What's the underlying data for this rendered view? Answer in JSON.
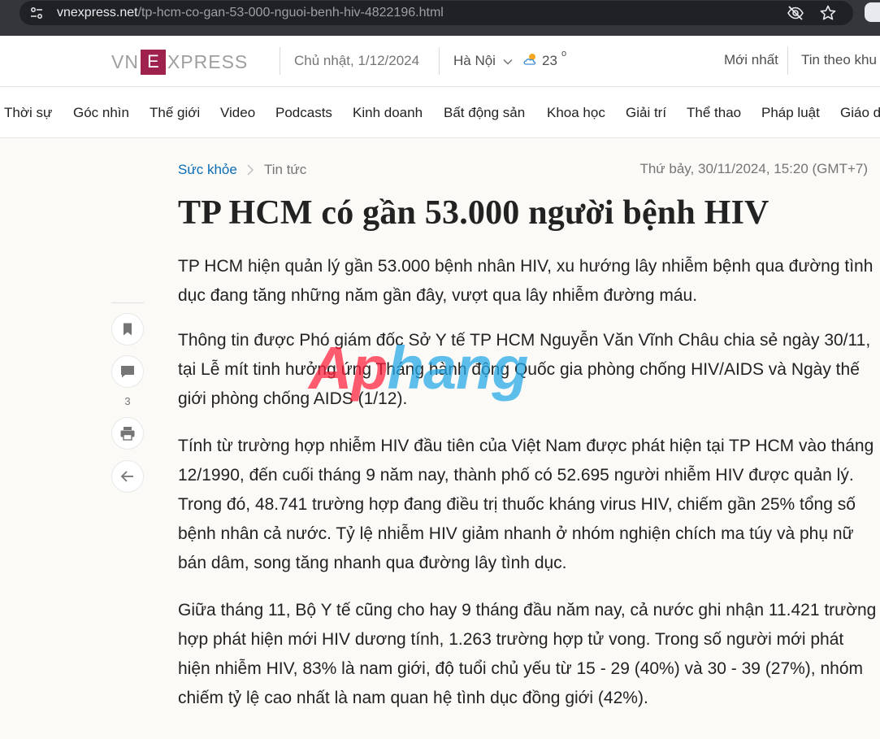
{
  "browser": {
    "url_domain": "vnexpress.net",
    "url_path": "/tp-hcm-co-gan-53-000-nguoi-benh-hiv-4822196.html"
  },
  "header": {
    "logo_left": "VN",
    "logo_e": "E",
    "logo_right": "XPRESS",
    "date": "Chủ nhật, 1/12/2024",
    "city": "Hà Nội",
    "temperature": "23",
    "degree": "o",
    "latest": "Mới nhất",
    "local_news": "Tin theo khu vực"
  },
  "nav": {
    "items": [
      "Thời sự",
      "Góc nhìn",
      "Thế giới",
      "Video",
      "Podcasts",
      "Kinh doanh",
      "Bất động sản",
      "Khoa học",
      "Giải trí",
      "Thể thao",
      "Pháp luật",
      "Giáo dục"
    ]
  },
  "tools": {
    "comment_count": "3"
  },
  "article": {
    "breadcrumb": [
      "Sức khỏe",
      "Tin tức"
    ],
    "published": "Thứ bảy, 30/11/2024, 15:20 (GMT+7)",
    "title": "TP HCM có gần 53.000 người bệnh HIV",
    "lead": "TP HCM hiện quản lý gần 53.000 bệnh nhân HIV, xu hướng lây nhiễm bệnh qua đường tình dục đang tăng những năm gần đây, vượt qua lây nhiễm đường máu.",
    "paragraphs": [
      "Thông tin được Phó giám đốc Sở Y tế TP HCM Nguyễn Văn Vĩnh Châu chia sẻ ngày 30/11, tại Lễ mít tinh hưởng ứng Tháng hành động Quốc gia phòng chống HIV/AIDS và Ngày thế giới phòng chống AIDS (1/12).",
      "Tính từ trường hợp nhiễm HIV đầu tiên của Việt Nam được phát hiện tại TP HCM vào tháng 12/1990, đến cuối tháng 9 năm nay, thành phố có 52.695 người nhiễm HIV được quản lý. Trong đó, 48.741 trường hợp đang điều trị thuốc kháng virus HIV, chiếm gần 25% tổng số bệnh nhân cả nước. Tỷ lệ nhiễm HIV giảm nhanh ở nhóm nghiện chích ma túy và phụ nữ bán dâm, song tăng nhanh qua đường lây tình dục.",
      "Giữa tháng 11, Bộ Y tế cũng cho hay 9 tháng đầu năm nay, cả nước ghi nhận 11.421 trường hợp phát hiện mới HIV dương tính, 1.263 trường hợp tử vong. Trong số người mới phát hiện nhiễm HIV, 83% là nam giới, độ tuổi chủ yếu từ 15 - 29 (40%) và 30 - 39 (27%), nhóm chiếm tỷ lệ cao nhất là nam quan hệ tình dục đồng giới (42%)."
    ]
  },
  "watermark": {
    "part_a": "Ap",
    "part_b": "hang"
  },
  "colors": {
    "brand": "#9f224e",
    "link": "#076db6",
    "browser_bar": "#35363a"
  }
}
